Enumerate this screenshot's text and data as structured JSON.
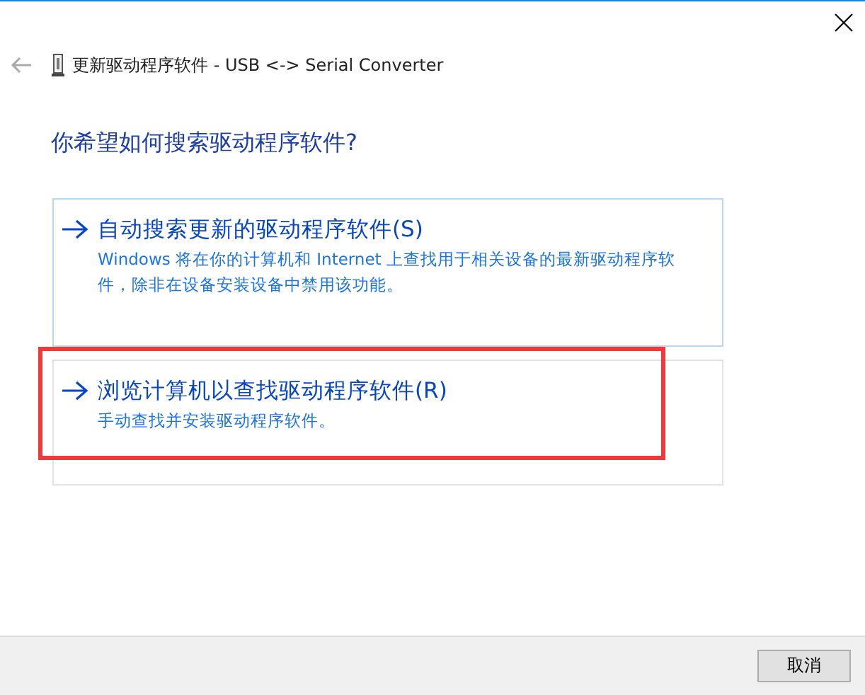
{
  "window": {
    "title": "更新驱动程序软件 - USB <-> Serial Converter"
  },
  "heading": "你希望如何搜索驱动程序软件?",
  "options": [
    {
      "title": "自动搜索更新的驱动程序软件(S)",
      "description": "Windows 将在你的计算机和 Internet 上查找用于相关设备的最新驱动程序软件，除非在设备安装设备中禁用该功能。",
      "selected": true,
      "highlighted": false
    },
    {
      "title": "浏览计算机以查找驱动程序软件(R)",
      "description": "手动查找并安装驱动程序软件。",
      "selected": false,
      "highlighted": true
    }
  ],
  "buttons": [
    "取消"
  ]
}
